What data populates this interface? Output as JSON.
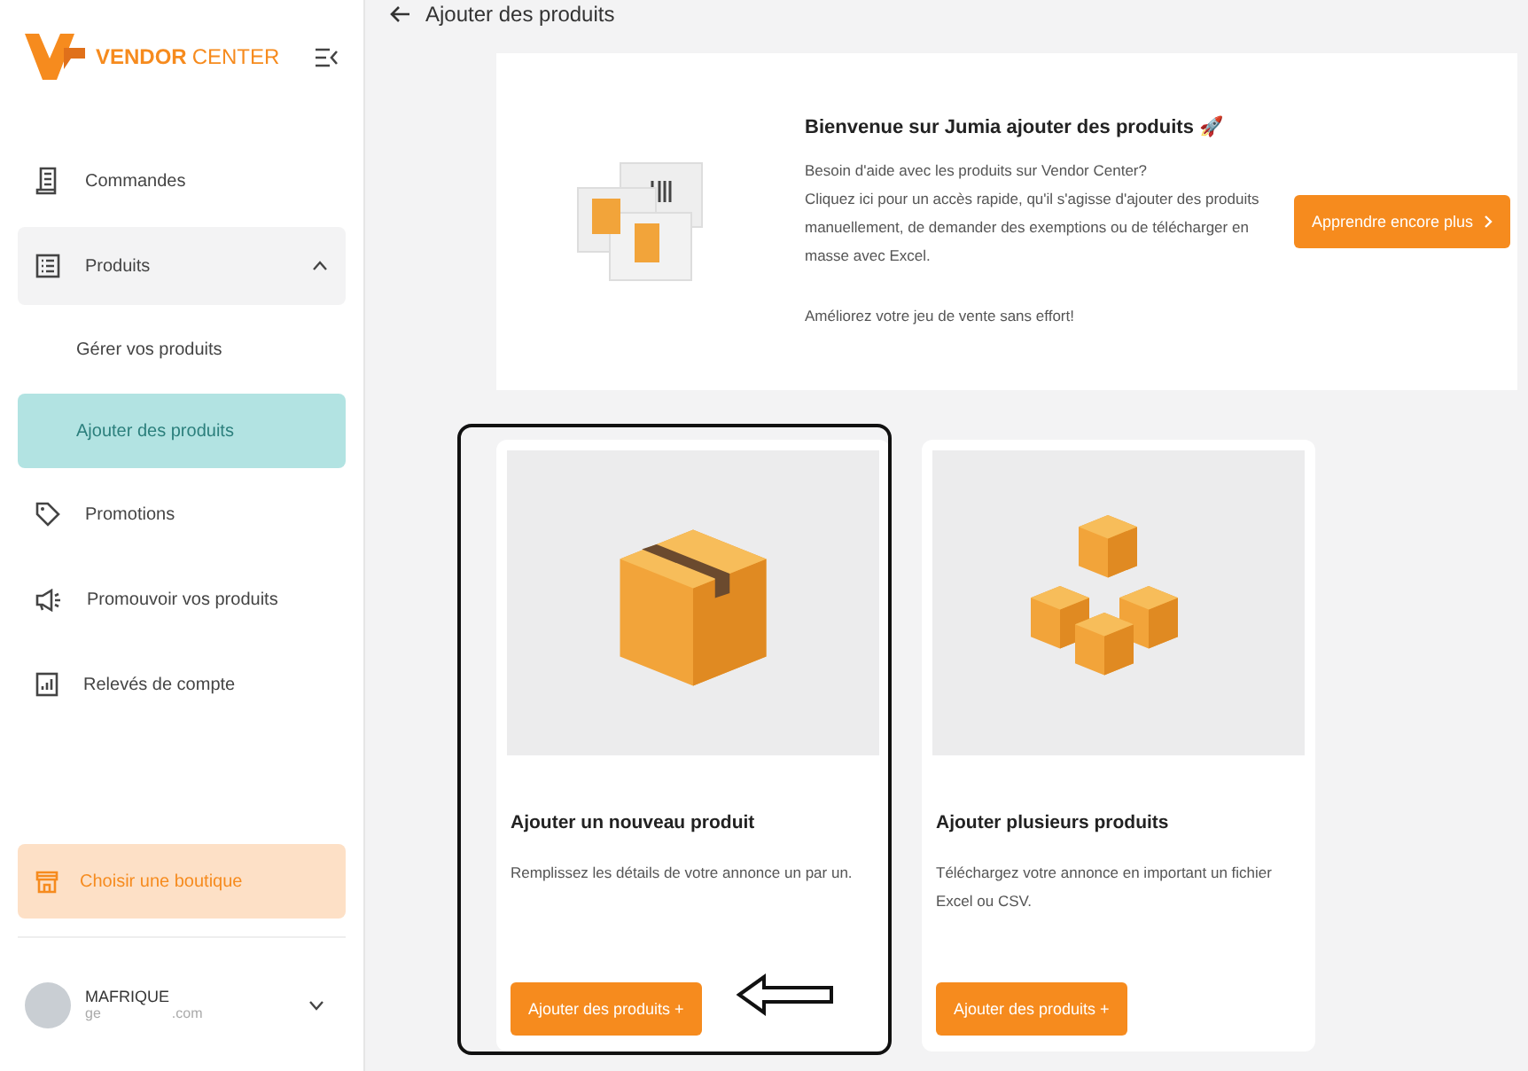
{
  "sidebar": {
    "logo": {
      "brand": "VENDOR",
      "suffix": "CENTER"
    },
    "items": [
      {
        "kind": "link",
        "label": "Commandes",
        "selected": false
      },
      {
        "kind": "group",
        "label": "Produits",
        "expanded": true,
        "selected": false,
        "children": [
          {
            "label": "Gérer vos produits",
            "selected": false
          },
          {
            "label": "Ajouter des produits",
            "selected": true
          }
        ]
      },
      {
        "kind": "link",
        "label": "Promotions",
        "selected": false
      },
      {
        "kind": "link",
        "label": "Promouvoir vos produits",
        "selected": false
      },
      {
        "kind": "link",
        "label": "Relevés de compte",
        "selected": false
      }
    ],
    "shop_button": "Choisir une boutique",
    "account": {
      "name": "MAFRIQUE",
      "email_start": "ge",
      "email_end": ".com"
    }
  },
  "header": {
    "title": "Ajouter des produits"
  },
  "banner": {
    "title": "Bienvenue sur Jumia ajouter des produits 🚀",
    "lines": [
      "Besoin d'aide avec les produits sur Vendor Center?",
      "Cliquez ici pour un accès rapide, qu'il s'agisse d'ajouter des produits manuellement, de demander des exemptions ou de télécharger en masse avec Excel."
    ],
    "footer": "Améliorez votre jeu de vente sans effort!",
    "button": "Apprendre encore plus"
  },
  "cards": [
    {
      "kind": "single",
      "title": "Ajouter un nouveau produit",
      "text": "Remplissez les détails de votre annonce un par un.",
      "button": "Ajouter des produits +",
      "highlighted": true
    },
    {
      "kind": "multiple",
      "title": "Ajouter plusieurs produits",
      "text": "Téléchargez votre annonce en important un fichier Excel ou CSV.",
      "button": "Ajouter des produits +",
      "highlighted": false
    }
  ]
}
